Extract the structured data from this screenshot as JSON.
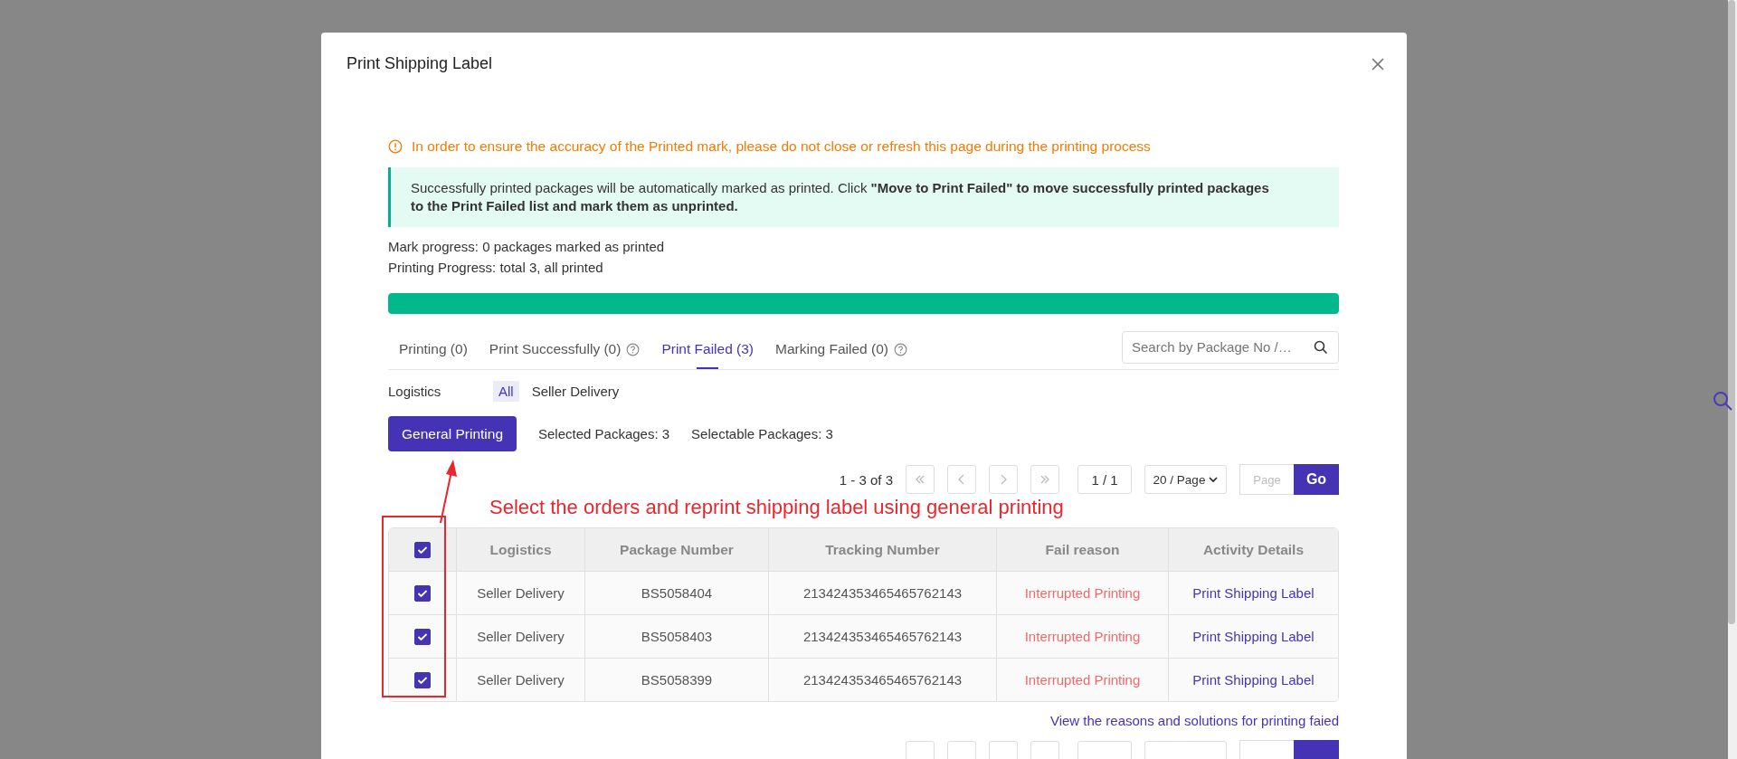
{
  "dialog": {
    "title": "Print Shipping Label"
  },
  "warning": "In order to ensure the accuracy of the Printed mark, please do not close or refresh this page during the printing process",
  "notice": "Successfully printed packages will be automatically marked as printed. Click **\"Move to Print Failed\" to move successfully printed packages to the Print Failed list and mark them as unprinted.**",
  "mark_progress": "Mark progress: 0 packages marked as printed",
  "printing_progress": "Printing Progress: total 3, all printed",
  "progress": {
    "level": 1
  },
  "tabs": [
    {
      "label": "Printing (0)",
      "selected": false,
      "help": false
    },
    {
      "label": "Print Successfully (0)",
      "selected": false,
      "help": true
    },
    {
      "label": "Print Failed (3)",
      "selected": true,
      "help": false
    },
    {
      "label": "Marking Failed (0)",
      "selected": false,
      "help": true
    }
  ],
  "search": {
    "placeholder": "Search by Package No /…"
  },
  "logistics_filter": {
    "label": "Logistics",
    "options": [
      {
        "label": "All",
        "selected": true
      },
      {
        "label": "Seller Delivery",
        "selected": false
      }
    ]
  },
  "actions": {
    "button": "General Printing",
    "selected_count": "Selected Packages: 3",
    "selectable_count": "Selectable Packages: 3"
  },
  "pager": {
    "summary": "1 - 3 of 3",
    "page": "1 / 1",
    "page_size": "20 / Page",
    "page_placeholder": "Page",
    "go": "Go"
  },
  "annotation": {
    "text": "Select the orders and reprint shipping label using general printing"
  },
  "table": {
    "select_all": true,
    "columns": [
      "Logistics",
      "Package Number",
      "Tracking Number",
      "Fail reason",
      "Activity Details"
    ],
    "rows": [
      {
        "checked": true,
        "logistics": "Seller Delivery",
        "package_number": "BS5058404",
        "tracking_number": "213424353465465762143",
        "fail_reason": "Interrupted Printing",
        "activity": "Print Shipping Label"
      },
      {
        "checked": true,
        "logistics": "Seller Delivery",
        "package_number": "BS5058403",
        "tracking_number": "213424353465465762143",
        "fail_reason": "Interrupted Printing",
        "activity": "Print Shipping Label"
      },
      {
        "checked": true,
        "logistics": "Seller Delivery",
        "package_number": "BS5058399",
        "tracking_number": "213424353465465762143",
        "fail_reason": "Interrupted Printing",
        "activity": "Print Shipping Label"
      }
    ]
  },
  "help_link": "View the reasons and solutions for printing faied"
}
